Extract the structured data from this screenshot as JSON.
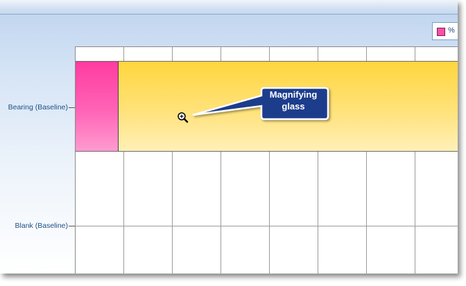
{
  "legend": {
    "label": "%",
    "color": "#ff4fa8",
    "swatch_icon": "pink-square-swatch"
  },
  "y_axis": {
    "categories": [
      "Bearing (Baseline)",
      "Blank (Baseline)"
    ]
  },
  "bars": {
    "pink_color": "#ff4fa8",
    "yellow_color": "#ffdc50"
  },
  "callout": {
    "line1": "Magnifying",
    "line2": "glass",
    "fill": "#1f3e8c"
  },
  "cursor": {
    "icon": "magnifying-glass-icon"
  }
}
